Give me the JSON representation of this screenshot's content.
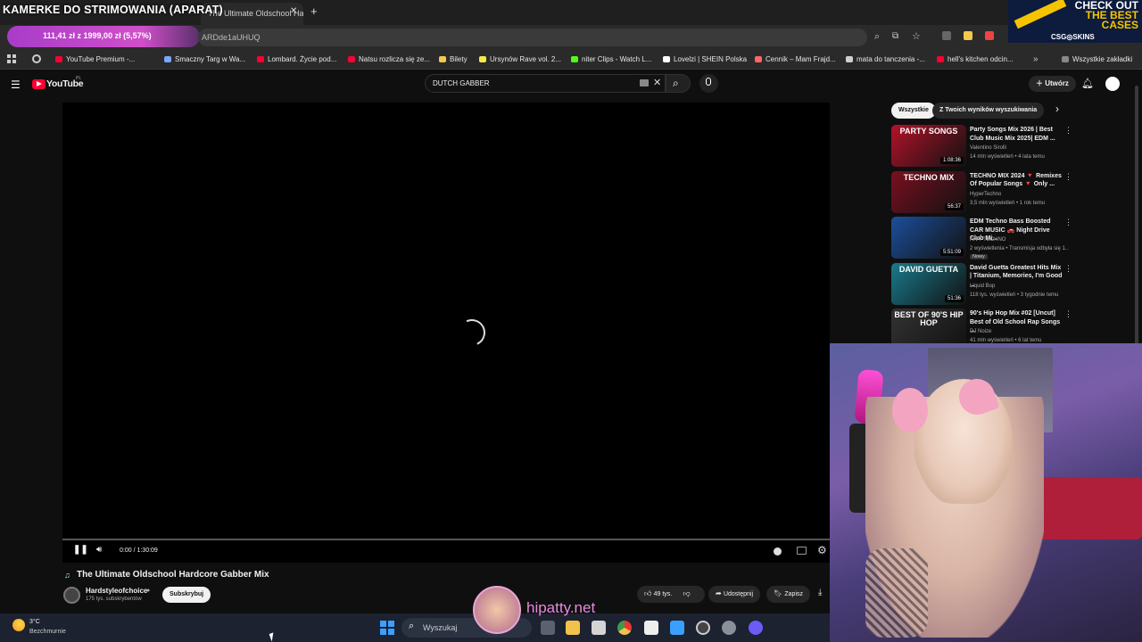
{
  "overlay": {
    "scene_title": "KAMERKE DO STRIMOWANIA (APARAT)",
    "donation": "111,41 zł z 1999,00 zł (5,57%)",
    "ad_line1": "CHECK OUT",
    "ad_line2": "THE BEST",
    "ad_line3": "CASES",
    "ad_brand": "CSG◎SKINS",
    "watermark": "hipatty.net"
  },
  "browser": {
    "active_tab": "The Ultimate Oldschool Ha",
    "url_fragment": "ARDde1aUHUQ",
    "bookmarks": [
      {
        "label": "YouTube Premium -...",
        "color": "#ff0033"
      },
      {
        "label": "Smaczny Targ w Wa...",
        "color": "#7aa7ff"
      },
      {
        "label": "Lombard. Życie pod...",
        "color": "#ff0033"
      },
      {
        "label": "Natsu rozlicza się ze...",
        "color": "#ff0033"
      },
      {
        "label": "Bilety",
        "color": "#f2c94c"
      },
      {
        "label": "Ursynów Rave vol. 2...",
        "color": "#f2e94c"
      },
      {
        "label": "niter Clips - Watch L...",
        "color": "#53fc18"
      },
      {
        "label": "Lovelzi | SHEIN Polska",
        "color": "#ffffff"
      },
      {
        "label": "Cennik – Mam Frajd...",
        "color": "#ff6666"
      },
      {
        "label": "mata do tanczenia -...",
        "color": "#cfcfcf"
      },
      {
        "label": "hell's kitchen odcin...",
        "color": "#ff0033"
      }
    ],
    "all_bookmarks": "Wszystkie zakładki"
  },
  "youtube": {
    "logo": "YouTube",
    "region": "PL",
    "search_value": "DUTCH GABBER",
    "create_label": "Utwórz",
    "time": "0:00 / 1:30:09",
    "video_title": "The Ultimate Oldschool Hardcore Gabber Mix",
    "channel": "Hardstyleofchoice",
    "subscribers": "175 tys. subskrybentów",
    "subscribe": "Subskrybuj",
    "likes": "49 tys.",
    "share": "Udostępnij",
    "save": "Zapisz",
    "filters": [
      "Wszystkie",
      "Z Twoich wyników wyszukiwania"
    ],
    "recommendations": [
      {
        "title": "Party Songs Mix 2026 | Best Club Music Mix 2025| EDM ...",
        "channel": "Valentino Sirolli",
        "meta": "14 mln wyświetleń • 4 lata temu",
        "duration": "1:08:36",
        "thumb_text": "PARTY SONGS",
        "thumb_color": "#b3122a",
        "badge": ""
      },
      {
        "title": "TECHNO MIX 2024 🔻 Remixes Of Popular Songs 🔻 Only ...",
        "channel": "HyperTechno",
        "meta": "3,5 mln wyświetleń • 1 rok temu",
        "duration": "56:37",
        "thumb_text": "TECHNO MIX",
        "thumb_color": "#7a1020",
        "badge": ""
      },
      {
        "title": "EDM Techno Bass Boosted CAR MUSIC 🚗 Night Drive Club Mi...",
        "channel": "AIVY TECHNO",
        "meta": "2 wyświetlenia • Transmisja odbyła się 1...",
        "duration": "5:51:09",
        "thumb_text": "",
        "thumb_color": "#1c4f9c",
        "badge": "Nowy"
      },
      {
        "title": "David Guetta Greatest Hits Mix | Titanium, Memories, I'm Good ...",
        "channel": "Liquid Bop",
        "meta": "118 tys. wyświetleń • 3 tygodnie temu",
        "duration": "51:36",
        "thumb_text": "DAVID GUETTA",
        "thumb_color": "#1a7a8c",
        "badge": ""
      },
      {
        "title": "90's Hip Hop Mix #02 [Uncut] Best of Old School Rap Songs ...",
        "channel": "DJ Noize",
        "meta": "41 mln wyświetleń • 6 lat temu",
        "duration": "",
        "thumb_text": "BEST OF 90'S HIP HOP",
        "thumb_color": "#333333",
        "badge": ""
      }
    ]
  },
  "taskbar": {
    "temp": "3°C",
    "weather": "Bezchmurnie",
    "search": "Wyszukaj"
  }
}
